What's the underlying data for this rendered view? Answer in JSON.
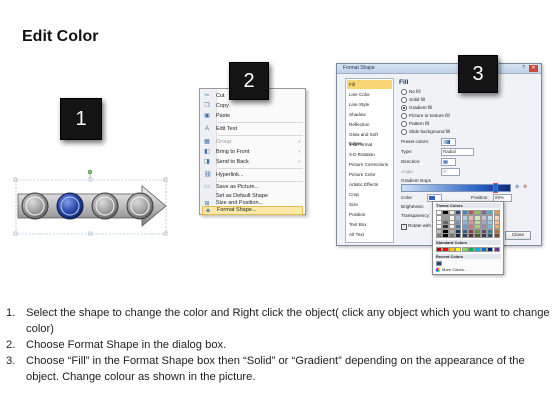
{
  "title": "Edit Color",
  "badges": [
    "1",
    "2",
    "3"
  ],
  "context_menu": {
    "items": [
      {
        "icon": "scissors-icon",
        "glyph": "✂",
        "label": "Cut",
        "state": "normal"
      },
      {
        "icon": "copy-icon",
        "glyph": "❐",
        "label": "Copy",
        "state": "normal"
      },
      {
        "icon": "paste-icon",
        "glyph": "▣",
        "label": "Paste",
        "state": "normal"
      },
      {
        "icon": "edit-text-icon",
        "glyph": "A",
        "label": "Edit Text",
        "state": "normal"
      },
      {
        "icon": "group-icon",
        "glyph": "▦",
        "label": "Group",
        "state": "disabled",
        "arrow": "›"
      },
      {
        "icon": "bring-to-front-icon",
        "glyph": "◧",
        "label": "Bring to Front",
        "state": "normal",
        "arrow": "›"
      },
      {
        "icon": "send-to-back-icon",
        "glyph": "◨",
        "label": "Send to Back",
        "state": "normal",
        "arrow": "›"
      },
      {
        "icon": "hyperlink-icon",
        "glyph": "⛓",
        "label": "Hyperlink...",
        "state": "normal"
      },
      {
        "icon": "save-picture-icon",
        "glyph": "▭",
        "label": "Save as Picture...",
        "state": "normal"
      },
      {
        "icon": "default-shape-icon",
        "glyph": "",
        "label": "Set as Default Shape",
        "state": "normal"
      },
      {
        "icon": "size-position-icon",
        "glyph": "⊞",
        "label": "Size and Position...",
        "state": "normal"
      },
      {
        "icon": "format-shape-icon",
        "glyph": "◈",
        "label": "Format Shape...",
        "state": "highlighted"
      }
    ]
  },
  "dialog": {
    "title": "Format Shape",
    "help": "?",
    "close": "✕",
    "categories": [
      "Fill",
      "Line Color",
      "Line Style",
      "Shadow",
      "Reflection",
      "Glow and Soft Edges",
      "3-D Format",
      "3-D Rotation",
      "Picture Corrections",
      "Picture Color",
      "Artistic Effects",
      "Crop",
      "Size",
      "Position",
      "Text Box",
      "Alt Text"
    ],
    "selected_category": "Fill",
    "pane_heading": "Fill",
    "fill_options": [
      {
        "label": "No fill",
        "selected": false
      },
      {
        "label": "Solid fill",
        "selected": false
      },
      {
        "label": "Gradient fill",
        "selected": true
      },
      {
        "label": "Picture or texture fill",
        "selected": false
      },
      {
        "label": "Pattern fill",
        "selected": false
      },
      {
        "label": "Slide background fill",
        "selected": false
      }
    ],
    "preset_colors_label": "Preset colors:",
    "type_label": "Type:",
    "type_value": "Radial",
    "direction_label": "Direction:",
    "angle_label": "Angle:",
    "angle_value": "0°",
    "gradient_stops_label": "Gradient stops",
    "color_label": "Color",
    "position_label": "Position:",
    "position_value": "89%",
    "brightness_label": "Brightness:",
    "transparency_label": "Transparency:",
    "rotate_label": "Rotate with shape",
    "close_button": "Close",
    "palette": {
      "theme_header": "Theme Colors",
      "standard_header": "Standard Colors",
      "recent_header": "Recent Colors",
      "more_colors": "More Colors...",
      "theme_top": [
        "#ffffff",
        "#000000",
        "#eeece1",
        "#1f497d",
        "#4f81bd",
        "#c0504d",
        "#9bbb59",
        "#8064a2",
        "#4bacc6",
        "#f79646"
      ],
      "standard": [
        "#c00000",
        "#ff0000",
        "#ffc000",
        "#ffff00",
        "#92d050",
        "#00b050",
        "#00b0f0",
        "#0070c0",
        "#002060",
        "#7030a0"
      ],
      "recent": [
        "#1f497d"
      ]
    }
  },
  "instructions": [
    {
      "num": "1.",
      "text": "Select the shape to change the color and Right click the object( click any object which you want to change color)"
    },
    {
      "num": "2.",
      "text": "Choose Format Shape in the dialog box."
    },
    {
      "num": "3.",
      "text": "Choose “Fill” in the Format Shape box then “Solid” or “Gradient” depending on the appearance of the object. Change colour as shown in the picture."
    }
  ],
  "colors": {
    "badge_bg": "#141414",
    "selected_circle": "#1f3f9a",
    "menu_highlight": "#fde9a8",
    "dialog_selected_category": "#f6d572"
  }
}
